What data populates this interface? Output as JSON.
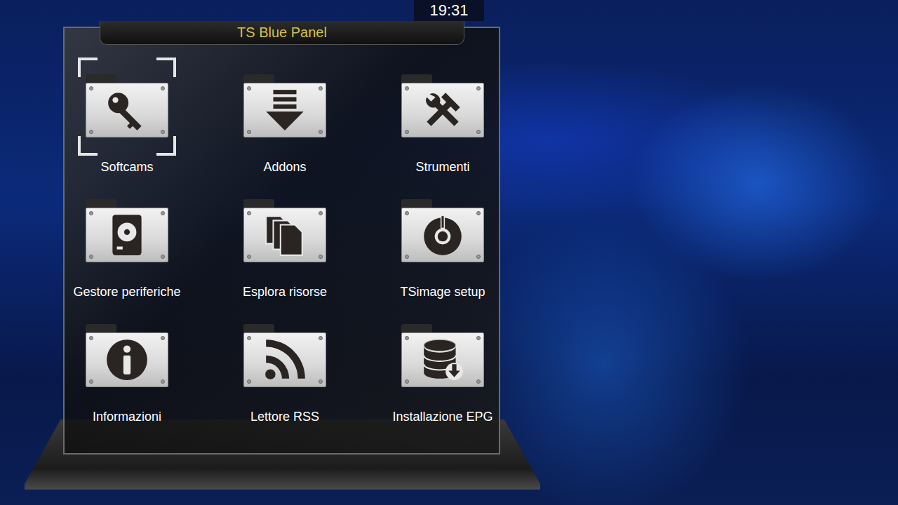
{
  "clock": "19:31",
  "panel": {
    "title": "TS Blue Panel",
    "items": [
      {
        "label": "Softcams",
        "selected": true
      },
      {
        "label": "Addons",
        "selected": false
      },
      {
        "label": "Strumenti",
        "selected": false
      },
      {
        "label": "Gestore periferiche",
        "selected": false
      },
      {
        "label": "Esplora risorse",
        "selected": false
      },
      {
        "label": "TSimage setup",
        "selected": false
      },
      {
        "label": "Informazioni",
        "selected": false
      },
      {
        "label": "Lettore RSS",
        "selected": false
      },
      {
        "label": "Installazione EPG",
        "selected": false
      }
    ]
  }
}
